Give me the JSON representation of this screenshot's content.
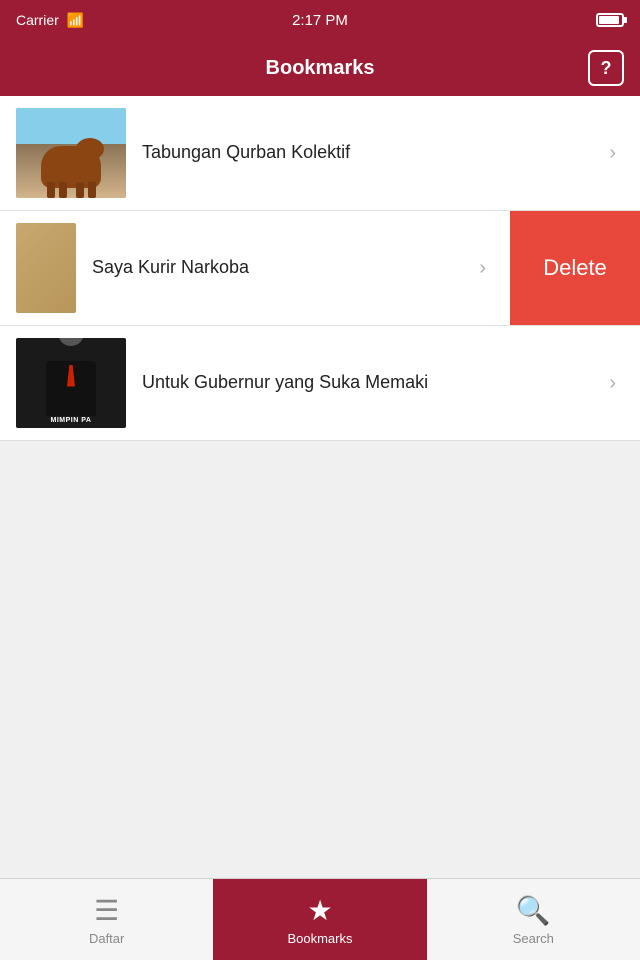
{
  "statusBar": {
    "carrier": "Carrier",
    "time": "2:17 PM"
  },
  "header": {
    "title": "Bookmarks",
    "iconLabel": "?"
  },
  "bookmarks": [
    {
      "id": 1,
      "title": "Tabungan Qurban Kolektif",
      "thumbType": "cow",
      "swipeOpen": false
    },
    {
      "id": 2,
      "title": "Saya Kurir Narkoba",
      "thumbType": "narko",
      "swipeOpen": true,
      "deleteLabel": "Delete"
    },
    {
      "id": 3,
      "title": "Untuk Gubernur yang Suka Memaki",
      "thumbType": "gov",
      "swipeOpen": false,
      "govLabel": "MIMPIN PA"
    }
  ],
  "bottomNav": {
    "items": [
      {
        "id": "daftar",
        "label": "Daftar",
        "icon": "list",
        "active": false
      },
      {
        "id": "bookmarks",
        "label": "Bookmarks",
        "icon": "star",
        "active": true
      },
      {
        "id": "search",
        "label": "Search",
        "icon": "search",
        "active": false
      }
    ]
  }
}
